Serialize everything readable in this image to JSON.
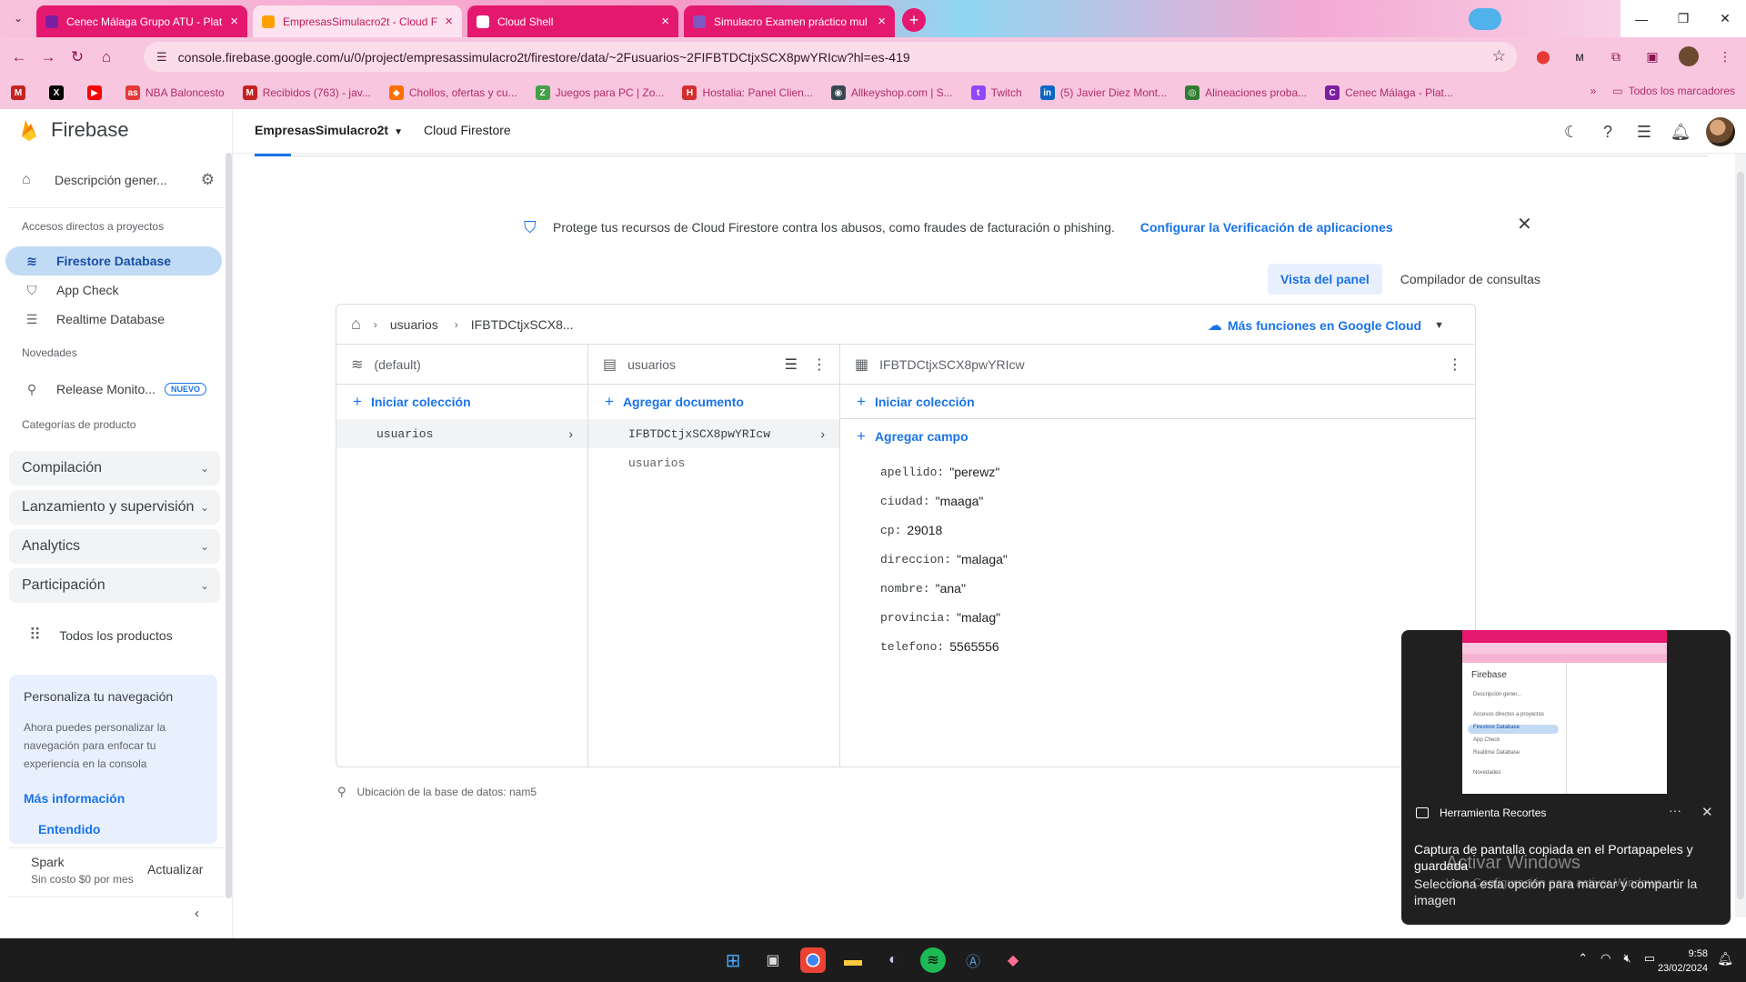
{
  "browser": {
    "tabs": [
      {
        "title": "Cenec Málaga Grupo ATU - Plat",
        "active": false,
        "favicon_color": "#7b1fa2"
      },
      {
        "title": "EmpresasSimulacro2t - Cloud F",
        "active": true,
        "favicon_color": "#ffa000"
      },
      {
        "title": "Cloud Shell",
        "active": false,
        "favicon_color": "#ffffff"
      },
      {
        "title": "Simulacro Examen práctico mul",
        "active": false,
        "favicon_color": "#7e57c2"
      }
    ],
    "url": "console.firebase.google.com/u/0/project/empresassimulacro2t/firestore/data/~2Fusuarios~2FIFBTDCtjxSCX8pwYRIcw?hl=es-419",
    "bookmarks": [
      {
        "label": "",
        "color": "#c5221f",
        "icon": "M"
      },
      {
        "label": "",
        "color": "#000000",
        "icon": "X"
      },
      {
        "label": "",
        "color": "#ff0000",
        "icon": "▶"
      },
      {
        "label": "NBA Baloncesto",
        "color": "#e53935",
        "icon": "as"
      },
      {
        "label": "Recibidos (763) - jav...",
        "color": "#c5221f",
        "icon": "M"
      },
      {
        "label": "Chollos, ofertas y cu...",
        "color": "#ff6f00",
        "icon": "◆"
      },
      {
        "label": "Juegos para PC | Zo...",
        "color": "#43a047",
        "icon": "Z"
      },
      {
        "label": "Hostalia: Panel Clien...",
        "color": "#d32f2f",
        "icon": "H"
      },
      {
        "label": "Allkeyshop.com | S...",
        "color": "#37474f",
        "icon": "◉"
      },
      {
        "label": "Twitch",
        "color": "#9146ff",
        "icon": "t"
      },
      {
        "label": "(5) Javier Diez Mont...",
        "color": "#0a66c2",
        "icon": "in"
      },
      {
        "label": "Alineaciones proba...",
        "color": "#2e7d32",
        "icon": "◎"
      },
      {
        "label": "Cenec Málaga - Plat...",
        "color": "#7b1fa2",
        "icon": "C"
      }
    ],
    "all_bookmarks": "Todos los marcadores"
  },
  "firebase": {
    "brand": "Firebase",
    "project": "EmpresasSimulacro2t",
    "service": "Cloud Firestore",
    "sidebar": {
      "overview": "Descripción gener...",
      "shortcuts_heading": "Accesos directos a proyectos",
      "shortcuts": [
        {
          "label": "Firestore Database",
          "icon": "firestore-icon",
          "active": true
        },
        {
          "label": "App Check",
          "icon": "shield-check-icon",
          "active": false
        },
        {
          "label": "Realtime Database",
          "icon": "database-icon",
          "active": false
        }
      ],
      "news_heading": "Novedades",
      "news_item": "Release Monito...",
      "news_badge": "NUEVO",
      "categories_heading": "Categorías de producto",
      "categories": [
        "Compilación",
        "Lanzamiento y supervisión",
        "Analytics",
        "Participación"
      ],
      "all_products": "Todos los productos",
      "promo": {
        "title": "Personaliza tu navegación",
        "description": "Ahora puedes personalizar la navegación para enfocar tu experiencia en la consola",
        "learn_more": "Más información",
        "got_it": "Entendido"
      },
      "plan_name": "Spark",
      "plan_subtitle": "Sin costo $0 por mes",
      "upgrade": "Actualizar"
    },
    "banner": {
      "text": "Protege tus recursos de Cloud Firestore contra los abusos, como fraudes de facturación o phishing.",
      "link": "Configurar la Verificación de aplicaciones"
    },
    "view_tabs": {
      "panel": "Vista del panel",
      "query": "Compilador de consultas"
    },
    "breadcrumb": {
      "collection": "usuarios",
      "document": "IFBTDCtjxSCX8..."
    },
    "gcloud_link": "Más funciones en Google Cloud",
    "columns": {
      "root": {
        "title": "(default)",
        "add": "Iniciar colección",
        "items": [
          "usuarios"
        ]
      },
      "collection": {
        "title": "usuarios",
        "add": "Agregar documento",
        "items": [
          "IFBTDCtjxSCX8pwYRIcw",
          "usuarios"
        ]
      },
      "document": {
        "title": "IFBTDCtjxSCX8pwYRIcw",
        "add_collection": "Iniciar colección",
        "add_field": "Agregar campo",
        "fields": [
          {
            "key": "apellido:",
            "value": "\"perewz\""
          },
          {
            "key": "ciudad:",
            "value": "\"maaga\""
          },
          {
            "key": "cp:",
            "value": "29018"
          },
          {
            "key": "direccion:",
            "value": "\"malaga\""
          },
          {
            "key": "nombre:",
            "value": "\"ana\""
          },
          {
            "key": "provincia:",
            "value": "\"malag\""
          },
          {
            "key": "telefono:",
            "value": "5565556"
          }
        ]
      }
    },
    "location": "Ubicación de la base de datos: nam5"
  },
  "toast": {
    "app": "Herramienta Recortes",
    "headline": "Captura de pantalla copiada en el Portapapeles y guardada",
    "body": "Selecciona esta opción para marcar y compartir la imagen",
    "thumb_items": [
      "Firebase",
      "Descripción gener...",
      "Accesos directos a proyectos",
      "Firestore Database",
      "App Check",
      "Realtime Database",
      "Novedades"
    ]
  },
  "watermark": {
    "title": "Activar Windows",
    "subtitle": "Ve a Configuración para activar Windows."
  },
  "taskbar": {
    "time": "9:58",
    "date": "23/02/2024"
  }
}
